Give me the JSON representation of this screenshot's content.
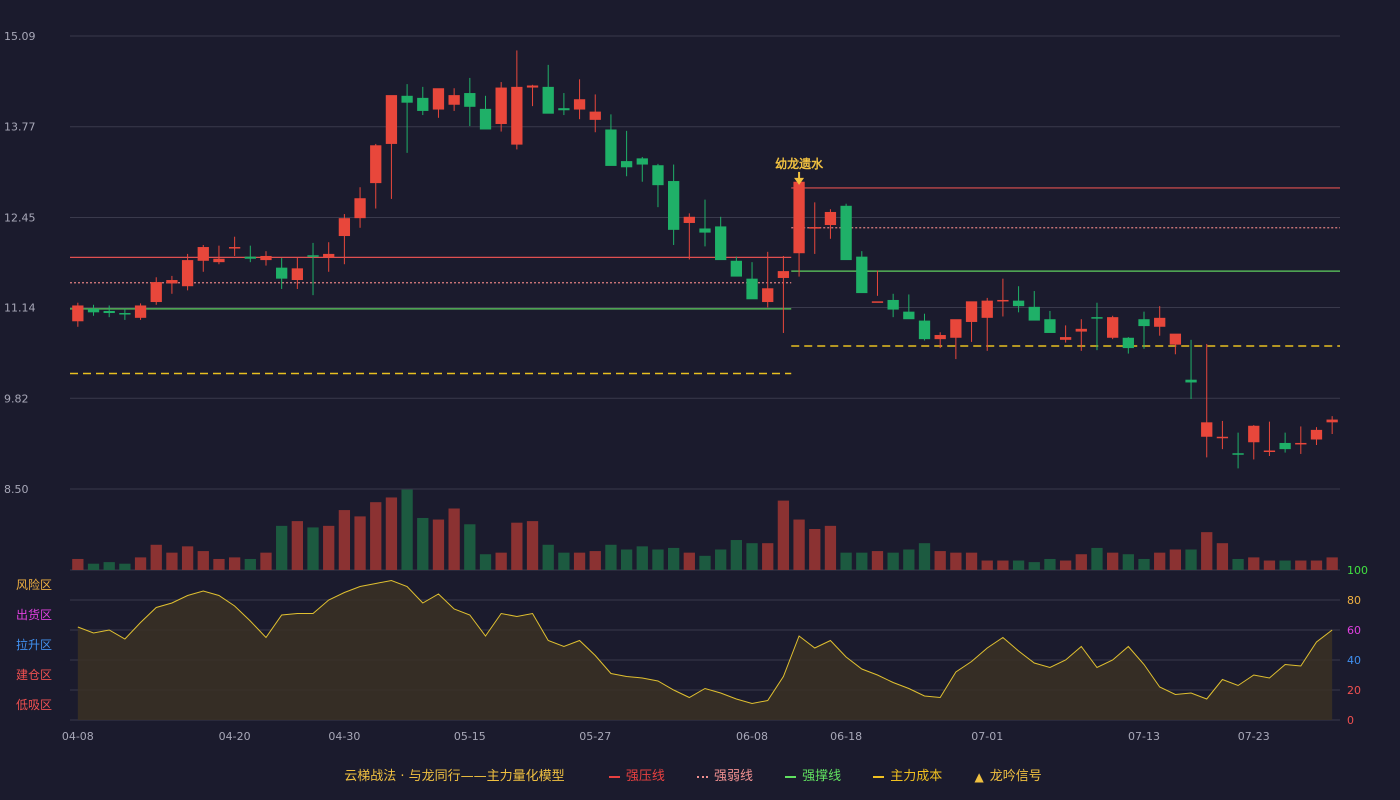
{
  "chart_data": {
    "type": "candlestick",
    "dates": [
      "04-08",
      "04-09",
      "04-10",
      "04-11",
      "04-12",
      "04-15",
      "04-16",
      "04-17",
      "04-18",
      "04-19",
      "04-20",
      "04-22",
      "04-23",
      "04-24",
      "04-25",
      "04-26",
      "04-29",
      "04-30",
      "05-06",
      "05-07",
      "05-08",
      "05-09",
      "05-10",
      "05-13",
      "05-14",
      "05-15",
      "05-16",
      "05-17",
      "05-20",
      "05-21",
      "05-22",
      "05-23",
      "05-24",
      "05-27",
      "05-28",
      "05-29",
      "05-30",
      "05-31",
      "06-03",
      "06-04",
      "06-05",
      "06-06",
      "06-07",
      "06-08",
      "06-11",
      "06-12",
      "06-13",
      "06-14",
      "06-17",
      "06-18",
      "06-19",
      "06-20",
      "06-21",
      "06-24",
      "06-25",
      "06-26",
      "06-27",
      "06-28",
      "07-01",
      "07-02",
      "07-03",
      "07-04",
      "07-05",
      "07-08",
      "07-09",
      "07-10",
      "07-11",
      "07-12",
      "07-13",
      "07-15",
      "07-16",
      "07-17",
      "07-18",
      "07-19",
      "07-22",
      "07-23",
      "07-24",
      "07-25",
      "07-26",
      "07-29",
      "07-30"
    ],
    "x_ticks": [
      "04-08",
      "04-20",
      "04-30",
      "05-15",
      "05-27",
      "06-08",
      "06-18",
      "07-01",
      "07-13",
      "07-23"
    ],
    "open": [
      10.94,
      11.12,
      11.09,
      11.06,
      10.99,
      11.22,
      11.49,
      11.45,
      11.82,
      11.8,
      12.01,
      11.88,
      11.83,
      11.72,
      11.54,
      11.9,
      11.87,
      12.18,
      12.44,
      12.95,
      13.52,
      14.22,
      14.19,
      14.02,
      14.09,
      14.26,
      14.03,
      13.81,
      13.51,
      14.34,
      14.35,
      14.04,
      14.02,
      13.87,
      13.73,
      13.27,
      13.31,
      13.21,
      12.98,
      12.37,
      12.29,
      12.32,
      11.82,
      11.56,
      11.22,
      11.57,
      11.93,
      12.3,
      12.34,
      12.62,
      11.88,
      11.23,
      11.25,
      11.08,
      10.95,
      10.68,
      10.7,
      10.93,
      10.99,
      11.24,
      11.24,
      11.15,
      10.97,
      10.67,
      10.79,
      11.0,
      10.7,
      10.7,
      10.97,
      10.86,
      10.6,
      10.09,
      9.26,
      9.24,
      9.02,
      9.18,
      9.06,
      9.17,
      9.15,
      9.22,
      9.47
    ],
    "close": [
      11.17,
      11.07,
      11.06,
      11.04,
      11.17,
      11.51,
      11.54,
      11.83,
      12.02,
      11.85,
      12.02,
      11.85,
      11.89,
      11.56,
      11.71,
      11.89,
      11.92,
      12.44,
      12.73,
      13.5,
      14.23,
      14.12,
      14.0,
      14.33,
      14.23,
      14.06,
      13.73,
      14.34,
      14.35,
      14.37,
      13.96,
      14.01,
      14.17,
      13.99,
      13.2,
      13.18,
      13.22,
      12.92,
      12.27,
      12.46,
      12.23,
      11.83,
      11.59,
      11.26,
      11.42,
      11.67,
      12.97,
      12.31,
      12.53,
      11.83,
      11.35,
      11.23,
      11.11,
      10.97,
      10.68,
      10.74,
      10.97,
      11.23,
      11.24,
      11.25,
      11.16,
      10.95,
      10.77,
      10.71,
      10.83,
      10.98,
      11.0,
      10.55,
      10.87,
      10.99,
      10.76,
      10.05,
      9.47,
      9.26,
      9.0,
      9.42,
      9.06,
      9.08,
      9.17,
      9.36,
      9.51
    ],
    "high": [
      11.21,
      11.18,
      11.17,
      11.12,
      11.2,
      11.58,
      11.6,
      11.92,
      12.05,
      12.04,
      12.17,
      12.04,
      11.96,
      11.86,
      11.86,
      12.08,
      12.09,
      12.5,
      12.89,
      13.52,
      13.67,
      14.39,
      14.35,
      14.19,
      14.33,
      14.48,
      14.22,
      14.42,
      14.88,
      14.38,
      14.67,
      14.26,
      14.46,
      14.24,
      13.95,
      13.71,
      13.33,
      13.23,
      13.22,
      12.51,
      12.71,
      12.46,
      11.88,
      11.8,
      11.95,
      11.89,
      12.97,
      12.67,
      12.57,
      12.65,
      11.96,
      11.68,
      11.34,
      11.33,
      11.05,
      10.78,
      10.8,
      10.98,
      11.28,
      11.56,
      11.45,
      11.38,
      11.09,
      10.88,
      10.97,
      11.21,
      11.02,
      10.71,
      11.08,
      11.16,
      10.75,
      10.67,
      10.61,
      9.49,
      9.32,
      9.43,
      9.48,
      9.32,
      9.41,
      9.4,
      9.56
    ],
    "low": [
      10.86,
      11.02,
      11.0,
      10.96,
      10.96,
      11.18,
      11.34,
      11.39,
      11.66,
      11.77,
      11.89,
      11.8,
      11.75,
      11.41,
      11.41,
      11.32,
      11.66,
      11.77,
      12.3,
      12.58,
      12.72,
      13.39,
      13.94,
      13.9,
      14.0,
      13.78,
      13.81,
      13.7,
      13.44,
      14.07,
      14.17,
      13.94,
      13.88,
      13.69,
      13.61,
      13.05,
      12.97,
      12.6,
      12.05,
      11.84,
      12.03,
      12.23,
      11.6,
      11.38,
      11.14,
      10.77,
      11.59,
      11.92,
      12.14,
      12.29,
      11.8,
      11.31,
      11.0,
      10.98,
      10.66,
      10.55,
      10.39,
      10.64,
      10.51,
      11.01,
      11.07,
      11.02,
      10.86,
      10.63,
      10.51,
      10.52,
      10.68,
      10.47,
      10.54,
      10.73,
      10.46,
      9.81,
      8.96,
      9.08,
      8.8,
      8.93,
      8.98,
      9.03,
      9.01,
      9.14,
      9.3
    ],
    "volume": [
      7,
      4,
      5,
      4,
      8,
      16,
      11,
      15,
      12,
      7,
      8,
      7,
      11,
      28,
      31,
      27,
      28,
      38,
      34,
      43,
      46,
      51,
      33,
      32,
      39,
      29,
      10,
      11,
      30,
      31,
      16,
      11,
      11,
      12,
      16,
      13,
      15,
      13,
      14,
      11,
      9,
      13,
      19,
      17,
      17,
      44,
      32,
      26,
      28,
      11,
      11,
      12,
      11,
      13,
      17,
      12,
      11,
      11,
      6,
      6,
      6,
      5,
      7,
      6,
      10,
      14,
      11,
      10,
      7,
      11,
      13,
      13,
      24,
      17,
      7,
      8,
      6,
      6,
      6,
      6,
      8
    ],
    "volume_ylim": [
      0,
      52
    ],
    "ylim": [
      8.5,
      15.09
    ],
    "y_ticks": [
      "8.50",
      "9.82",
      "11.14",
      "12.45",
      "13.77",
      "15.09"
    ],
    "levels": [
      {
        "name": "强压线",
        "value": 11.87,
        "x_range": [
          "04-08",
          "06-12"
        ],
        "style": "solid",
        "color": "#e05050"
      },
      {
        "name": "强弱线",
        "value": 11.5,
        "x_range": [
          "04-08",
          "06-12"
        ],
        "style": "dotted",
        "color": "#e08080"
      },
      {
        "name": "强撑线",
        "value": 11.12,
        "x_range": [
          "04-08",
          "06-12"
        ],
        "style": "solid",
        "color": "#5fd05f"
      },
      {
        "name": "主力成本",
        "value": 10.18,
        "x_range": [
          "04-08",
          "06-12"
        ],
        "style": "dashed",
        "color": "#e8c020"
      },
      {
        "name": "强压线",
        "value": 12.88,
        "x_range": [
          "06-13",
          "07-30"
        ],
        "style": "solid",
        "color": "#e05050"
      },
      {
        "name": "强弱线",
        "value": 12.3,
        "x_range": [
          "06-13",
          "07-30"
        ],
        "style": "dotted",
        "color": "#e08080"
      },
      {
        "name": "强撑线",
        "value": 11.67,
        "x_range": [
          "06-13",
          "07-30"
        ],
        "style": "solid",
        "color": "#5fd05f"
      },
      {
        "name": "主力成本",
        "value": 10.58,
        "x_range": [
          "06-13",
          "07-30"
        ],
        "style": "dashed",
        "color": "#e8c020"
      }
    ],
    "annotation": {
      "text": "幼龙遗水",
      "date": "06-13",
      "value": 12.88
    },
    "oscillator": {
      "values": [
        62,
        58,
        60,
        54,
        65,
        75,
        78,
        83,
        86,
        83,
        76,
        66,
        55,
        70,
        71,
        71,
        80,
        85,
        89,
        91,
        93,
        89,
        78,
        84,
        74,
        70,
        56,
        71,
        69,
        71,
        53,
        49,
        53,
        43,
        31,
        29,
        28,
        26,
        20,
        15,
        21,
        18,
        14,
        11,
        13,
        29,
        56,
        48,
        53,
        42,
        34,
        30,
        25,
        21,
        16,
        15,
        32,
        39,
        48,
        55,
        46,
        38,
        35,
        40,
        49,
        35,
        40,
        49,
        37,
        22,
        17,
        18,
        14,
        27,
        23,
        30,
        28,
        37,
        36,
        52,
        60
      ],
      "ylim": [
        0,
        100
      ],
      "right_ticks": [
        "0",
        "20",
        "40",
        "60",
        "80",
        "100"
      ],
      "zones": [
        {
          "label": "风险区",
          "color": "#f0b040"
        },
        {
          "label": "出货区",
          "color": "#e040e0"
        },
        {
          "label": "拉升区",
          "color": "#4090f0"
        },
        {
          "label": "建仓区",
          "color": "#f05050"
        },
        {
          "label": "低吸区",
          "color": "#f05050"
        }
      ]
    },
    "colors": {
      "up": "#e8473b",
      "down": "#1fb068",
      "up_vol": "#8b3232",
      "down_vol": "#1c5a40",
      "osc_line": "#e0c030",
      "osc_fill": "#3a3024",
      "grid": "#3a3a4c",
      "axis_text": "#a8a8b8",
      "bg": "#1b1b2d"
    }
  },
  "legend": {
    "description": "云梯战法 · 与龙同行——主力量化模型",
    "items": [
      {
        "label": "强压线",
        "symbol": "line",
        "color": "#e84040"
      },
      {
        "label": "强弱线",
        "symbol": "dot",
        "color": "#f09090"
      },
      {
        "label": "强撑线",
        "symbol": "line",
        "color": "#60e060"
      },
      {
        "label": "主力成本",
        "symbol": "dash",
        "color": "#f0c020"
      },
      {
        "label": "龙吟信号",
        "symbol": "tri",
        "color": "#f0c040"
      }
    ]
  }
}
